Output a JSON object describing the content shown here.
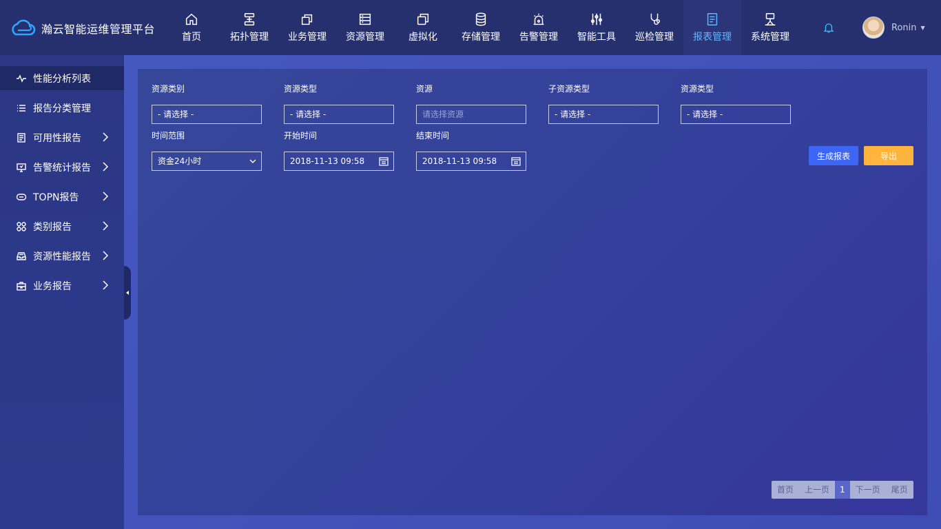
{
  "header": {
    "logo_text": "瀚云智能运维管理平台",
    "nav": [
      {
        "label": "首页",
        "icon": "home-icon"
      },
      {
        "label": "拓扑管理",
        "icon": "topology-icon"
      },
      {
        "label": "业务管理",
        "icon": "business-icon"
      },
      {
        "label": "资源管理",
        "icon": "resource-icon"
      },
      {
        "label": "虚拟化",
        "icon": "virtualization-icon"
      },
      {
        "label": "存储管理",
        "icon": "storage-icon"
      },
      {
        "label": "告警管理",
        "icon": "alarm-icon"
      },
      {
        "label": "智能工具",
        "icon": "tools-icon"
      },
      {
        "label": "巡检管理",
        "icon": "inspection-icon"
      },
      {
        "label": "报表管理",
        "icon": "report-icon",
        "active": true
      },
      {
        "label": "系统管理",
        "icon": "system-icon"
      }
    ],
    "user_name": "Ronin",
    "accent_color": "#5fb7ff"
  },
  "sidebar": {
    "items": [
      {
        "label": "性能分析列表",
        "icon": "pulse-icon",
        "active": true
      },
      {
        "label": "报告分类管理",
        "icon": "list-icon"
      },
      {
        "label": "可用性报告",
        "icon": "document-icon",
        "has_children": true
      },
      {
        "label": "告警统计报告",
        "icon": "monitor-icon",
        "has_children": true
      },
      {
        "label": "TOPN报告",
        "icon": "topn-icon",
        "has_children": true
      },
      {
        "label": "类别报告",
        "icon": "category-icon",
        "has_children": true
      },
      {
        "label": "资源性能报告",
        "icon": "inbox-icon",
        "has_children": true
      },
      {
        "label": "业务报告",
        "icon": "briefcase-icon",
        "has_children": true
      }
    ]
  },
  "filters": {
    "resource_category": {
      "label": "资源类别",
      "value": "- 请选择 -"
    },
    "resource_type": {
      "label": "资源类型",
      "value": "- 请选择 -"
    },
    "resource": {
      "label": "资源",
      "placeholder": "请选择资源"
    },
    "sub_resource_type": {
      "label": "子资源类型",
      "value": "- 请选择 -"
    },
    "resource_type_2": {
      "label": "资源类型",
      "value": "- 请选择 -"
    },
    "time_range": {
      "label": "时间范围",
      "value": "资金24小时"
    },
    "start_time": {
      "label": "开始时间",
      "value": "2018-11-13 09:58"
    },
    "end_time": {
      "label": "结束时间",
      "value": "2018-11-13 09:58"
    }
  },
  "actions": {
    "generate_label": "生成报表",
    "export_label": "导出",
    "generate_color": "#3d66f5",
    "export_color": "#ffb43d"
  },
  "pagination": {
    "first": "首页",
    "prev": "上一页",
    "current": "1",
    "next": "下一页",
    "last": "尾页"
  }
}
